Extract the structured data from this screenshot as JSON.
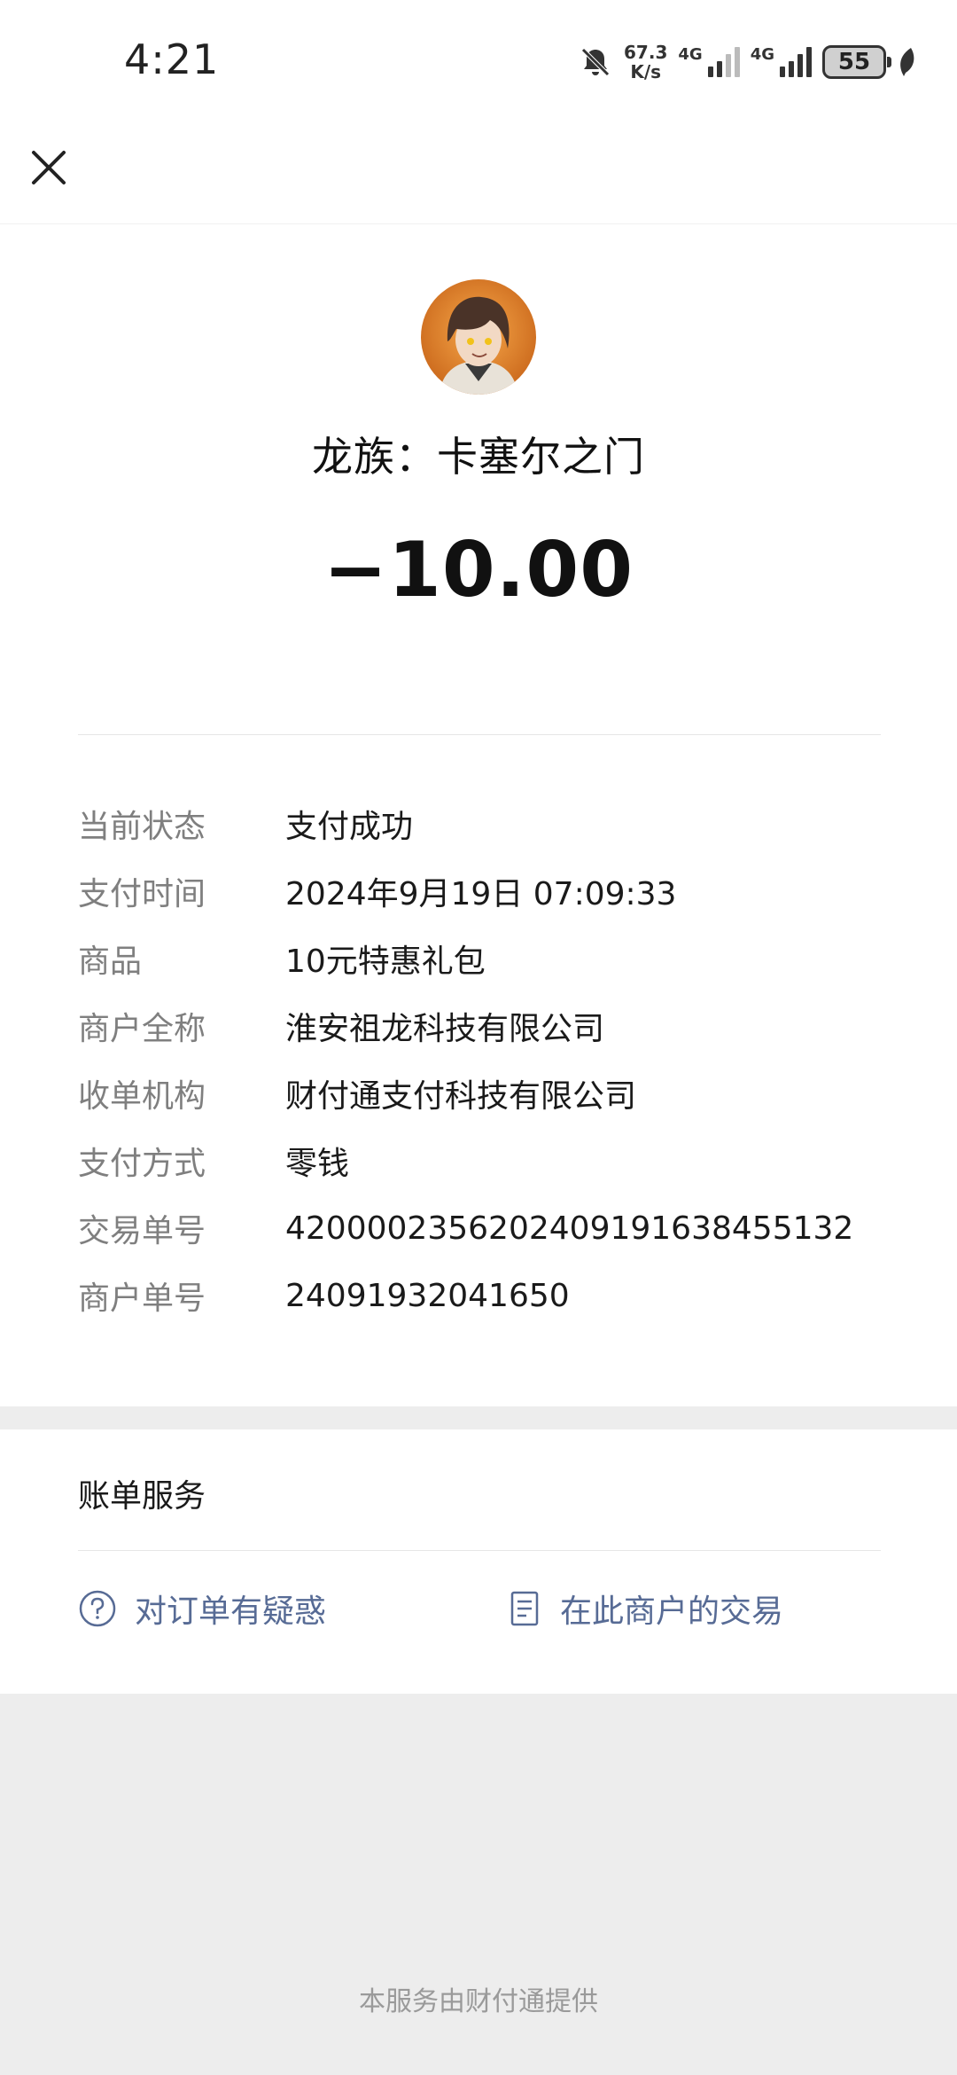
{
  "status_bar": {
    "time": "4:21",
    "net_speed_value": "67.3",
    "net_speed_unit": "K/s",
    "signal1_label": "4G",
    "signal2_label": "4G",
    "battery": "55",
    "icons": [
      "bell-off-icon",
      "signal-icon",
      "battery-icon",
      "leaf-icon"
    ]
  },
  "nav": {
    "close_icon": "close-icon"
  },
  "transaction": {
    "merchant_name": "龙族：卡塞尔之门",
    "amount": "−10.00",
    "details": [
      {
        "label": "当前状态",
        "value": "支付成功"
      },
      {
        "label": "支付时间",
        "value": "2024年9月19日 07:09:33"
      },
      {
        "label": "商品",
        "value": "10元特惠礼包"
      },
      {
        "label": "商户全称",
        "value": "淮安祖龙科技有限公司"
      },
      {
        "label": "收单机构",
        "value": "财付通支付科技有限公司"
      },
      {
        "label": "支付方式",
        "value": "零钱"
      },
      {
        "label": "交易单号",
        "value": "4200002356202409191638455132"
      },
      {
        "label": "商户单号",
        "value": "24091932041650"
      }
    ]
  },
  "bill_service": {
    "title": "账单服务",
    "question_label": "对订单有疑惑",
    "merchant_trades_label": "在此商户的交易",
    "link_color": "#576b95"
  },
  "footer": {
    "text": "本服务由财付通提供"
  }
}
